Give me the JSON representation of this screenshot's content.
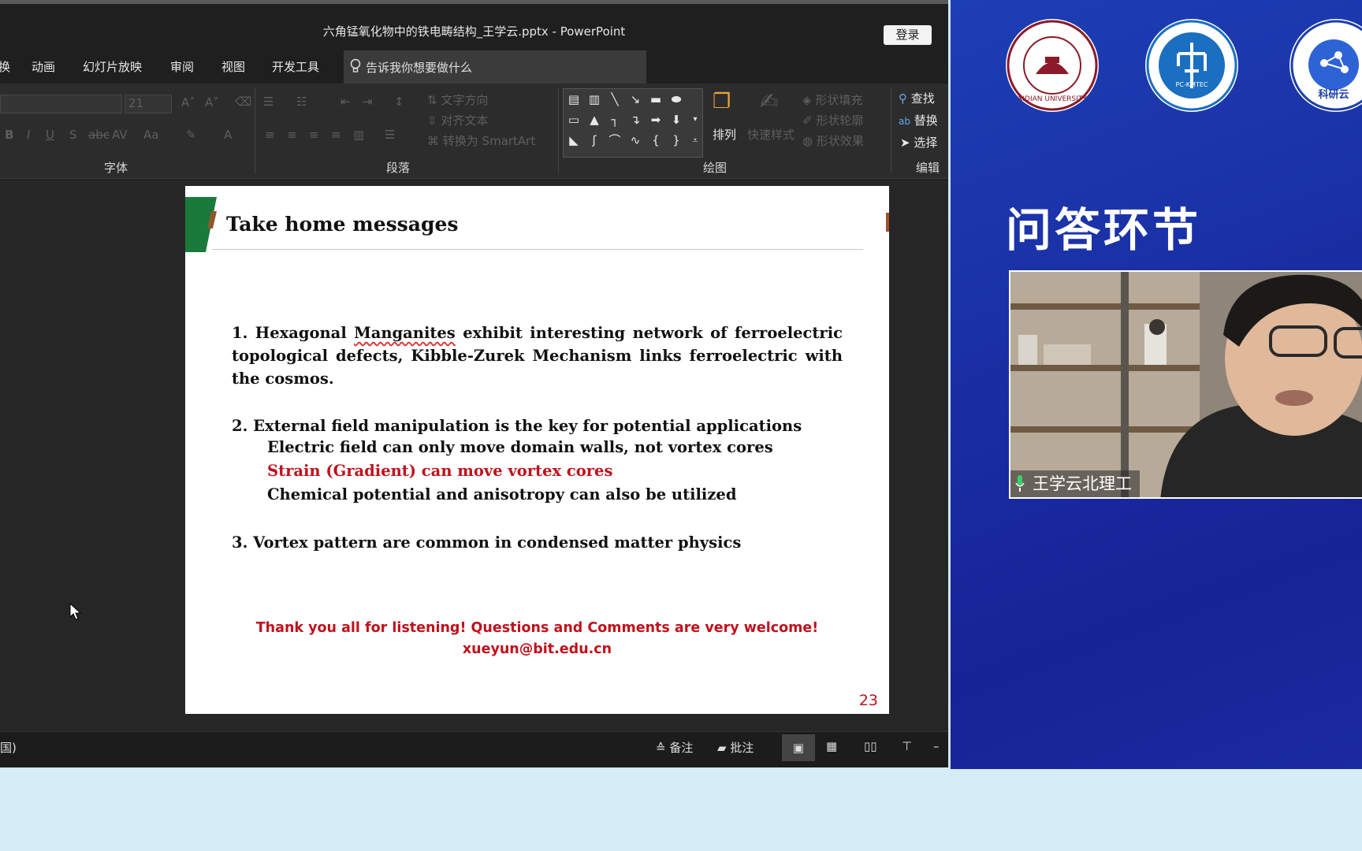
{
  "window": {
    "title": "六角锰氧化物中的铁电畴结构_王学云.pptx  -  PowerPoint",
    "login_label": "登录"
  },
  "menu": {
    "items": [
      "换",
      "动画",
      "幻灯片放映",
      "审阅",
      "视图",
      "开发工具"
    ],
    "tell_me": "告诉我你想要做什么"
  },
  "ribbon": {
    "font_size": "21",
    "groups": {
      "font": "字体",
      "paragraph": "段落",
      "drawing": "绘图",
      "editing": "编辑"
    },
    "paragraph_buttons": [
      "文字方向",
      "对齐文本",
      "转换为 SmartArt"
    ],
    "drawing_buttons": {
      "arrange": "排列",
      "quick_styles": "快速样式",
      "fill": "形状填充",
      "outline": "形状轮廓",
      "effects": "形状效果"
    },
    "editing_buttons": [
      "查找",
      "替换",
      "选择"
    ]
  },
  "slide": {
    "heading": "Take home messages",
    "p1_prefix": "1. Hexagonal ",
    "p1_underlined": "Manganites",
    "p1_suffix": " exhibit interesting network of ferroelectric topological defects, Kibble-Zurek Mechanism links ferroelectric with the cosmos.",
    "p2": "2. External field manipulation is the key for potential applications",
    "p2_subs": [
      "Electric field can only move domain walls, not vortex cores",
      "Strain (Gradient) can move vortex cores",
      "Chemical potential and anisotropy can also be utilized"
    ],
    "p3": "3. Vortex pattern are common in condensed matter physics",
    "thanks": "Thank you all for listening! Questions and Comments are very welcome!",
    "email": "xueyun@bit.edu.cn",
    "page_number": "23",
    "colors": {
      "accent_red": "#c0111c",
      "tab_green": "#1a7a3c"
    }
  },
  "statusbar": {
    "left_text": "国)",
    "notes": "备注",
    "comments": "批注"
  },
  "panel": {
    "heading": "问答环节",
    "logos": [
      "XIDIAN UNIVERSITY",
      "PC-KMTEC",
      "科研云"
    ],
    "participant_name": "王学云北理工"
  }
}
